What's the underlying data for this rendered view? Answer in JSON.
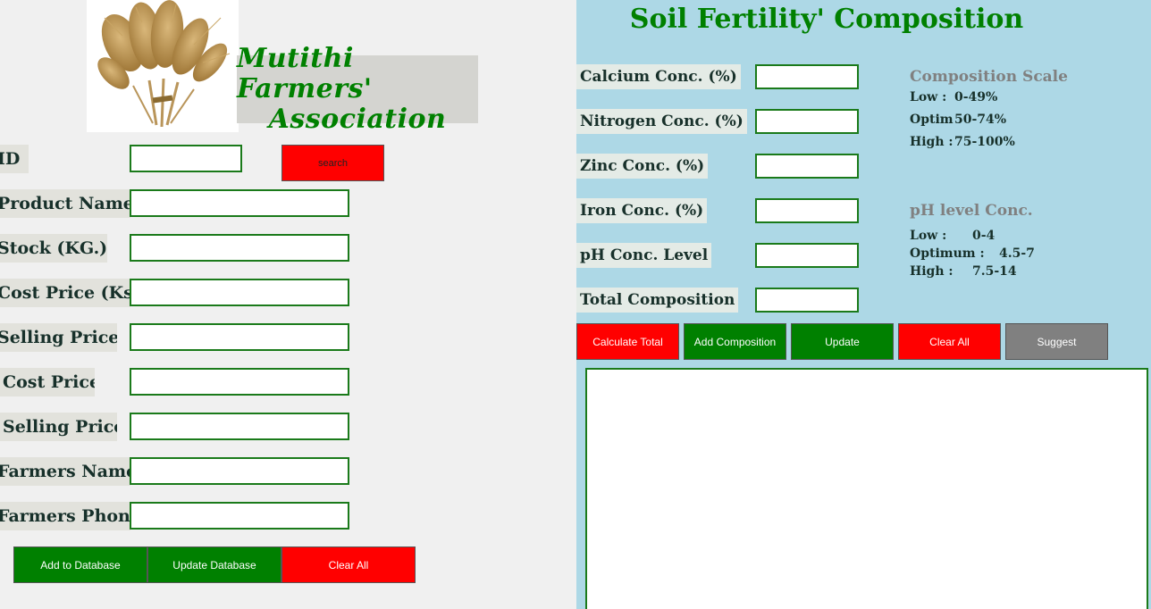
{
  "brand": {
    "line1": "Mutithi Farmers'",
    "line2": "Association"
  },
  "product_form": {
    "fields": [
      {
        "label": "ID",
        "value": ""
      },
      {
        "label": "Product Name",
        "value": ""
      },
      {
        "label": "Stock (KG.)",
        "value": ""
      },
      {
        "label": "Cost Price (Ks",
        "value": ""
      },
      {
        "label": "Selling Price",
        "value": ""
      },
      {
        "label": "Cost Price",
        "value": ""
      },
      {
        "label": "Selling Price",
        "value": ""
      },
      {
        "label": "Farmers Name",
        "value": ""
      },
      {
        "label": "Farmers Phon",
        "value": ""
      }
    ],
    "search_label": "search",
    "buttons": {
      "add": "Add to Database",
      "update": "Update Database",
      "clear": "Clear All"
    }
  },
  "soil": {
    "title": "Soil Fertility' Composition",
    "fields": [
      {
        "label": "Calcium Conc. (%)",
        "value": ""
      },
      {
        "label": "Nitrogen Conc. (%)",
        "value": ""
      },
      {
        "label": "Zinc Conc. (%)",
        "value": ""
      },
      {
        "label": "Iron Conc. (%)",
        "value": ""
      },
      {
        "label": "pH Conc. Level",
        "value": ""
      },
      {
        "label": "Total Composition",
        "value": ""
      }
    ],
    "buttons": {
      "calculate": "Calculate Total",
      "add": "Add Composition",
      "update": "Update",
      "clear": "Clear All",
      "suggest": "Suggest"
    },
    "composition_scale": {
      "title": "Composition Scale",
      "rows": [
        {
          "key": "Low :",
          "value": "0-49%"
        },
        {
          "key": "Optim",
          "value": "50-74%"
        },
        {
          "key": "High :",
          "value": "75-100%"
        }
      ]
    },
    "ph_scale": {
      "title": "pH level Conc.",
      "rows": [
        {
          "key": "Low :",
          "value": "0-4"
        },
        {
          "key": "Optimum :",
          "value": "4.5-7"
        },
        {
          "key": "High :",
          "value": "7.5-14"
        }
      ]
    },
    "output_text": ""
  },
  "colors": {
    "accent_green": "#008000",
    "danger_red": "#ff0000",
    "neutral_gray": "#808080",
    "panel_blue": "#add8e6"
  }
}
